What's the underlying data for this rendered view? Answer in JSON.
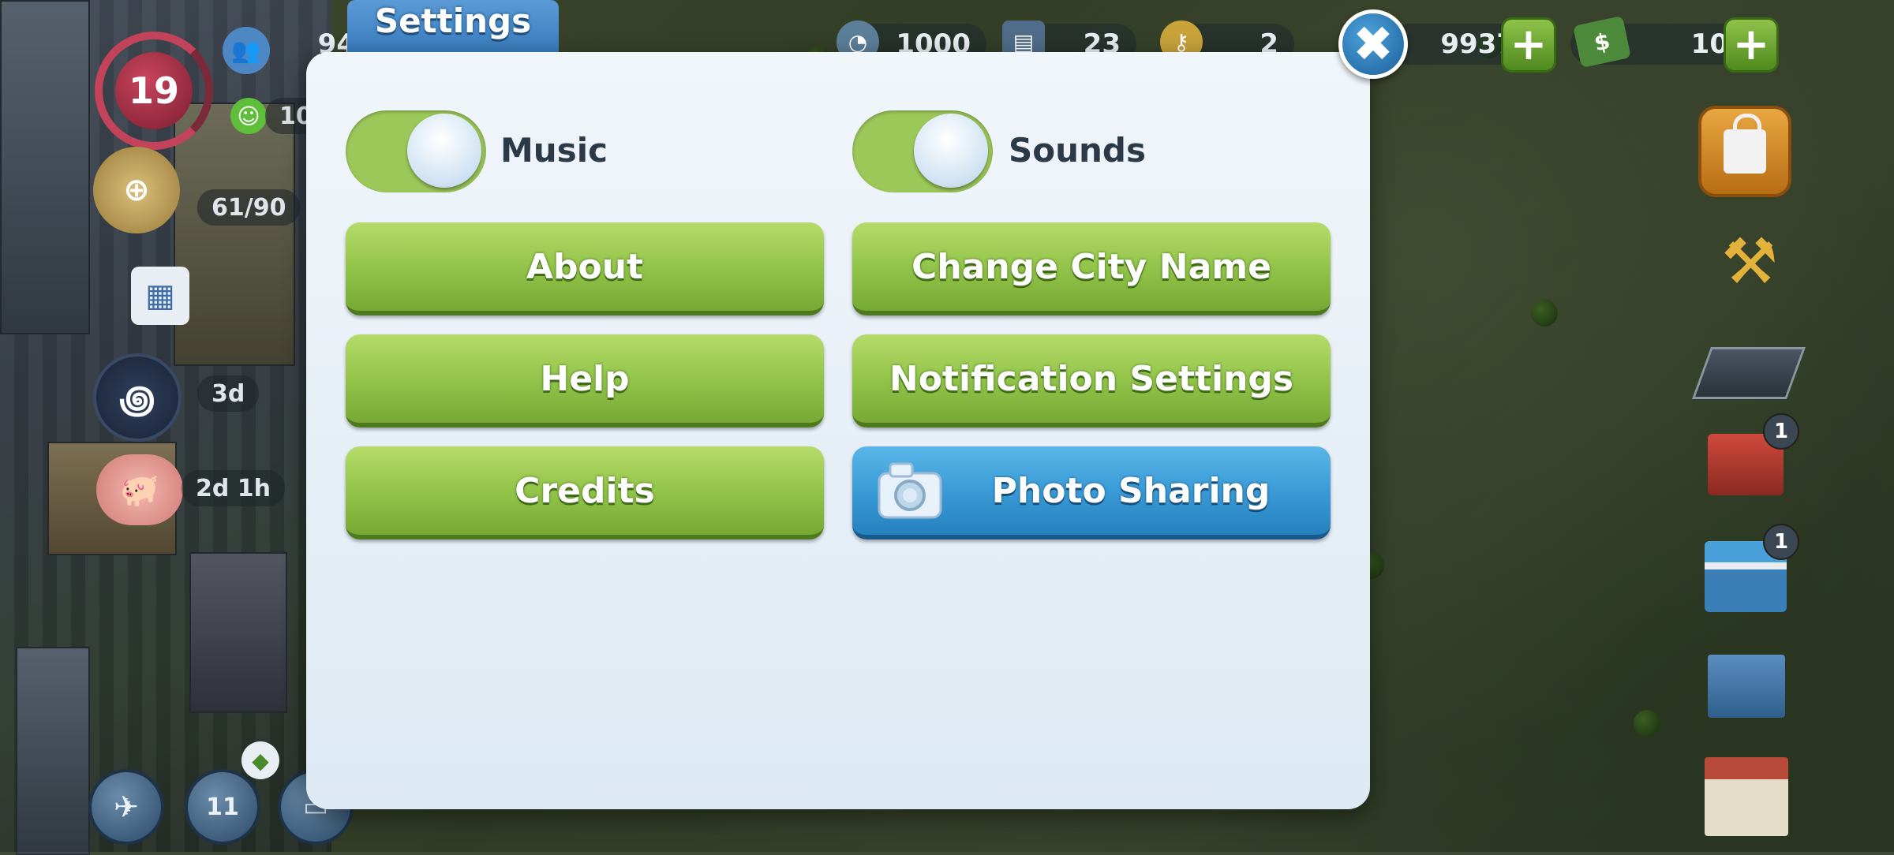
{
  "dialog": {
    "tab_title": "Settings",
    "close_glyph": "✖",
    "toggles": [
      {
        "label": "Music",
        "state": "on"
      },
      {
        "label": "Sounds",
        "state": "on"
      }
    ],
    "buttons": {
      "about": "About",
      "change_city_name": "Change City Name",
      "help": "Help",
      "notification_settings": "Notification Settings",
      "credits": "Credits",
      "photo_sharing": "Photo Sharing"
    }
  },
  "resources": {
    "stat1": "94",
    "stat2": "1000",
    "stat3": "23",
    "stat4": "2",
    "coins": "9937",
    "cash": "10"
  },
  "hud": {
    "level": "19",
    "happiness": "10",
    "population_cap": "61/90",
    "timer1": "3d",
    "timer2": "2d 1h",
    "region_badge": "11"
  },
  "toolbar": {
    "residential_badge": "1",
    "commercial_badge": "1"
  },
  "colors": {
    "accent_green": "#93c44a",
    "accent_blue": "#3a9bd6",
    "dialog_bg": "#e8f0f7"
  }
}
